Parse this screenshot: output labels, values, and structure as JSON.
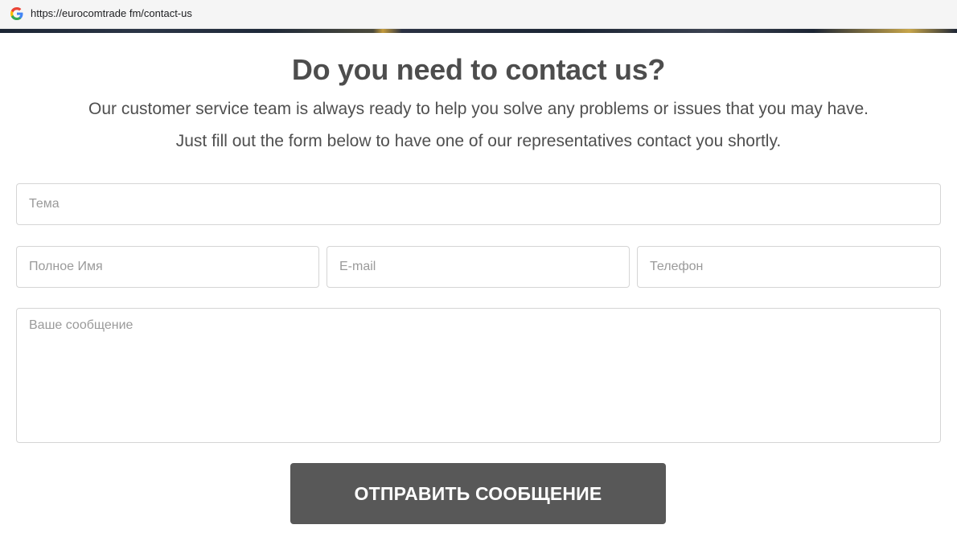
{
  "browser": {
    "url": "https://eurocomtrade fm/contact-us",
    "favicon": "google-g-icon"
  },
  "page": {
    "title": "Do you need to contact us?",
    "subtitle_line1": "Our customer service team is always ready to help you solve any problems or issues that you may have.",
    "subtitle_line2": "Just fill out the form below to have one of our representatives contact you shortly."
  },
  "form": {
    "subject_placeholder": "Тема",
    "fullname_placeholder": "Полное Имя",
    "email_placeholder": "E-mail",
    "phone_placeholder": "Телефон",
    "message_placeholder": "Ваше сообщение",
    "submit_label": "ОТПРАВИТЬ СООБЩЕНИЕ"
  },
  "colors": {
    "button_bg": "#585858",
    "text": "#4d4d4d",
    "field_border": "#d5d5d5"
  }
}
